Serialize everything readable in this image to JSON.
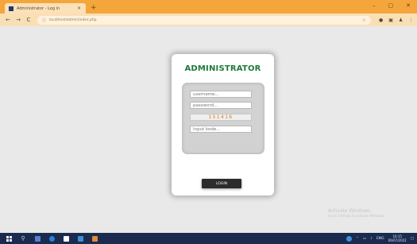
{
  "browser": {
    "tab_title": "Administrator - Log in",
    "tab_close": "×",
    "new_tab": "+",
    "window_controls": {
      "minimize": "–",
      "maximize": "▢",
      "close": "✕"
    },
    "nav": {
      "back": "←",
      "forward": "→",
      "reload": "C"
    },
    "url": "localhost/admin/index.php",
    "url_lock": "ⓘ",
    "bookmark_star": "☆"
  },
  "login": {
    "title": "ADMINISTRATOR",
    "username_placeholder": "username...",
    "password_placeholder": "password...",
    "captcha_code": "151416",
    "captcha_input_placeholder": "Input kode...",
    "login_label": "LOGIN"
  },
  "watermark": {
    "title": "Activate Windows",
    "subtitle": "Go to Settings to activate Windows."
  },
  "taskbar": {
    "search": "⚲",
    "apps": [
      {
        "name": "task-view",
        "color": "#5a7fcf"
      },
      {
        "name": "edge",
        "color": "#2e7fd6"
      },
      {
        "name": "store",
        "color": "#ffffff"
      },
      {
        "name": "mail",
        "color": "#3f8fd8"
      },
      {
        "name": "pinned-app",
        "color": "#e08a3a"
      }
    ],
    "time": "10:15",
    "date": "06/07/2022",
    "lang": "ENG"
  },
  "colors": {
    "title_green": "#1e7a3a",
    "captcha_orange": "#e07a0a",
    "tabbar_orange": "#f4a63c",
    "taskbar_navy": "#1a2b4f"
  }
}
